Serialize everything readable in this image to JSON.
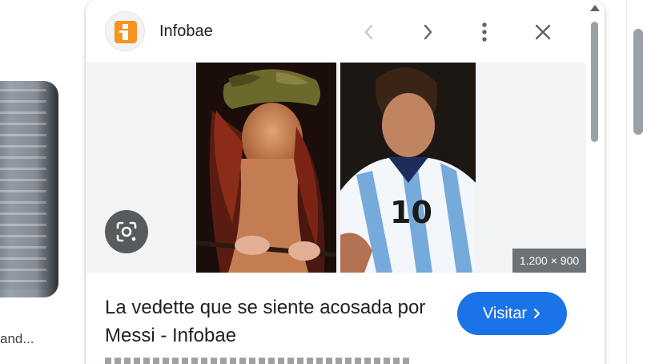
{
  "background_result": {
    "caption": "and..."
  },
  "panel": {
    "source_name": "Infobae",
    "icons": {
      "logo": "infobae-logo-icon",
      "prev": "chevron-left-icon",
      "next": "chevron-right-icon",
      "more": "more-vert-icon",
      "close": "close-icon",
      "lens": "google-lens-icon"
    },
    "image_dimensions": "1.200 × 900",
    "title": "La vedette que se siente acosada por Messi - Infobae",
    "visit_label": "Visitar",
    "colors": {
      "brand_orange": "#f7931e",
      "visit_blue": "#1a73e8",
      "argentina_blue": "#75aadb"
    }
  }
}
